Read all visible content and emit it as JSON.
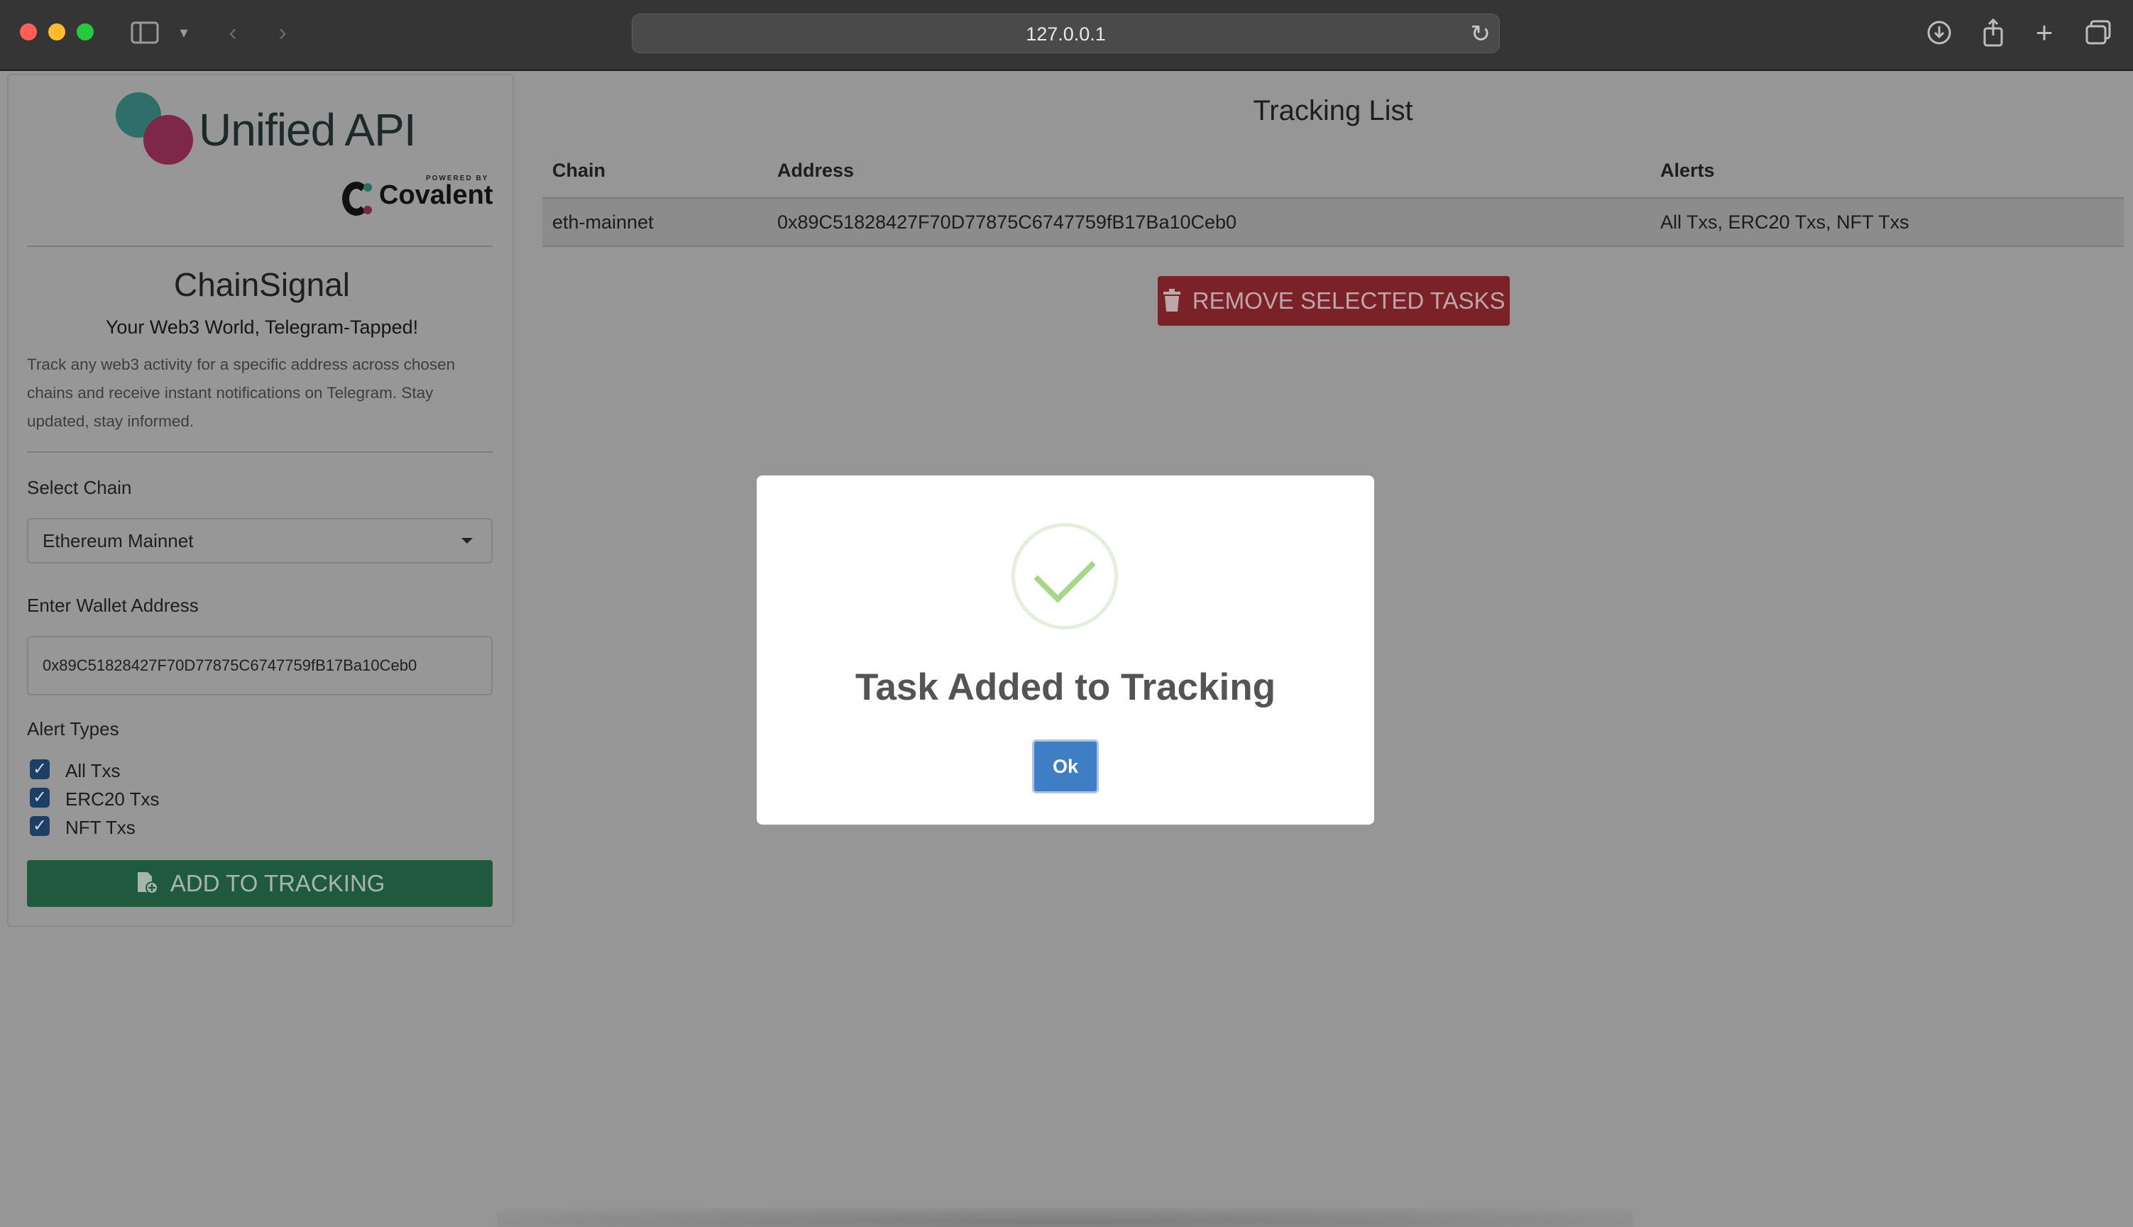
{
  "browser": {
    "url": "127.0.0.1"
  },
  "sidebar": {
    "brand": "Unified API",
    "powered_by": "POWERED BY",
    "brand_partner": "Covalent",
    "app_title": "ChainSignal",
    "tagline": "Your Web3 World, Telegram-Tapped!",
    "description": "Track any web3 activity for a specific address across chosen chains and receive instant notifications on Telegram. Stay updated, stay informed.",
    "chain_label": "Select Chain",
    "chain_value": "Ethereum Mainnet",
    "wallet_label": "Enter Wallet Address",
    "wallet_value": "0x89C51828427F70D77875C6747759fB17Ba10Ceb0",
    "alert_label": "Alert Types",
    "alerts": [
      {
        "label": "All Txs",
        "checked": true
      },
      {
        "label": "ERC20 Txs",
        "checked": true
      },
      {
        "label": "NFT Txs",
        "checked": true
      }
    ],
    "add_button": "ADD TO TRACKING"
  },
  "main": {
    "title": "Tracking List",
    "columns": [
      "Chain",
      "Address",
      "Alerts"
    ],
    "rows": [
      {
        "chain": "eth-mainnet",
        "address": "0x89C51828427F70D77875C6747759fB17Ba10Ceb0",
        "alerts": "All Txs, ERC20 Txs, NFT Txs"
      }
    ],
    "remove_button": "REMOVE SELECTED TASKS"
  },
  "modal": {
    "title": "Task Added to Tracking",
    "ok_button": "Ok",
    "icon": "success-check-icon"
  },
  "colors": {
    "add_button": "#1f5a3e",
    "remove_button": "#7a2227",
    "ok_button": "#3f7ec5",
    "success_check": "#a5d68a"
  }
}
